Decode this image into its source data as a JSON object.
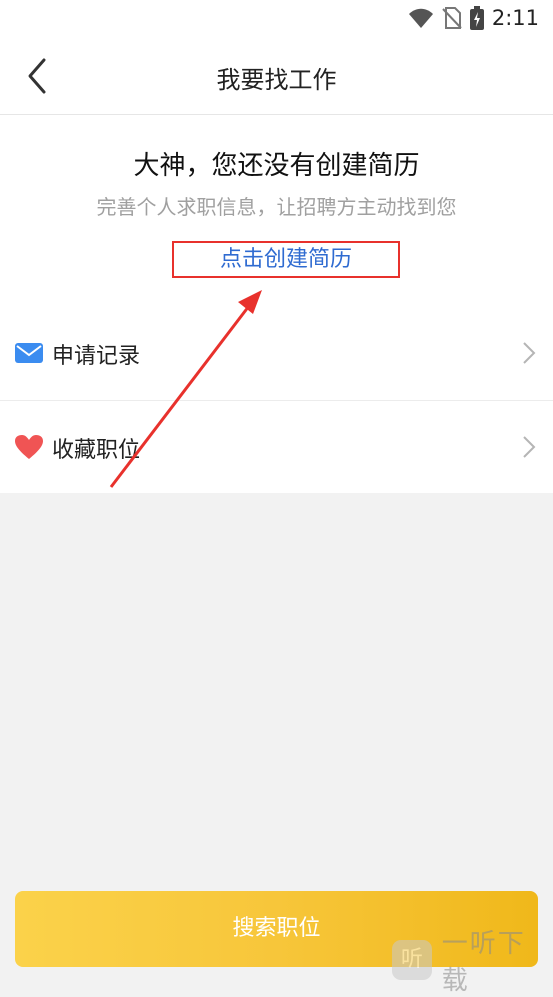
{
  "status_bar": {
    "time": "2:11",
    "icons": [
      "wifi-icon",
      "no-sim-icon",
      "battery-charging-icon"
    ]
  },
  "nav": {
    "title": "我要找工作",
    "back_icon": "chevron-left-icon"
  },
  "resume": {
    "headline": "大神，您还没有创建简历",
    "subtitle": "完善个人求职信息，让招聘方主动找到您",
    "create_link": "点击创建简历"
  },
  "list": {
    "items": [
      {
        "label": "申请记录",
        "icon": "mail-icon"
      },
      {
        "label": "收藏职位",
        "icon": "heart-icon"
      }
    ]
  },
  "footer": {
    "search_button": "搜索职位"
  },
  "watermark": {
    "logo": "听",
    "text": "一听下载"
  },
  "colors": {
    "accent_yellow": "#f7c63a",
    "link_blue": "#2f6bd1",
    "highlight_red": "#e8312c",
    "mail_blue": "#3b8cf0",
    "heart_red": "#f05454"
  }
}
